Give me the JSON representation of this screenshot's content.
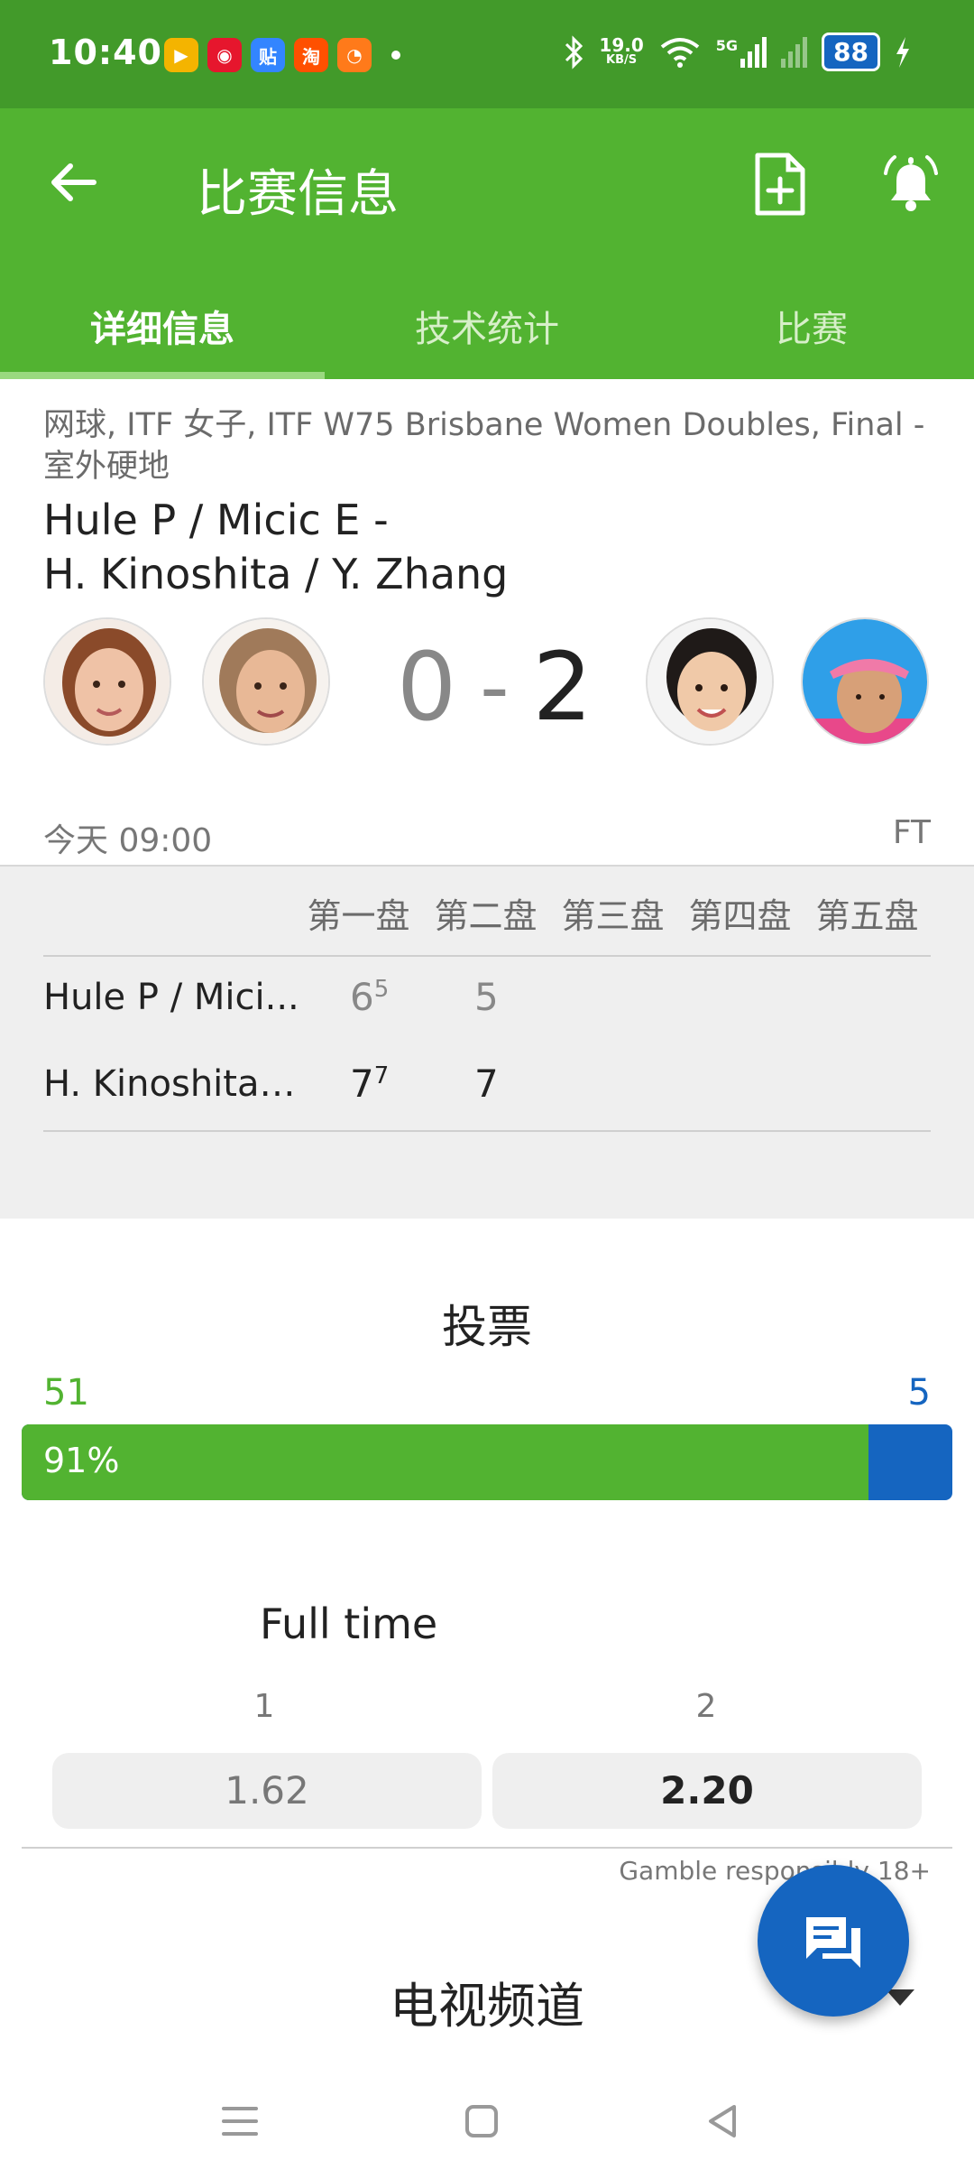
{
  "status_bar": {
    "time": "10:40",
    "net_speed_value": "19.0",
    "net_speed_unit": "KB/S",
    "network": "5G",
    "battery": "88",
    "app_icons": [
      {
        "name": "video-app-icon",
        "color": "#f4b400"
      },
      {
        "name": "weibo-icon",
        "color": "#e6162d"
      },
      {
        "name": "tieba-icon",
        "color": "#3385ff"
      },
      {
        "name": "taobao-icon",
        "color": "#ff5000"
      },
      {
        "name": "orange-app-icon",
        "color": "#ff7a1a"
      }
    ]
  },
  "app_bar": {
    "title": "比赛信息",
    "tabs": [
      {
        "label": "详细信息",
        "active": true
      },
      {
        "label": "技术统计",
        "active": false
      },
      {
        "label": "比赛",
        "active": false
      }
    ]
  },
  "match": {
    "league": "网球, ITF 女子, ITF W75 Brisbane Women Doubles, Final - 室外硬地",
    "team1": "Hule P / Micic E -",
    "team2": "H. Kinoshita / Y. Zhang",
    "score_home": "0",
    "score_sep": "-",
    "score_away": "2",
    "start_time": "今天 09:00",
    "status": "FT"
  },
  "sets": {
    "headers": [
      "第一盘",
      "第二盘",
      "第三盘",
      "第四盘",
      "第五盘"
    ],
    "rows": [
      {
        "team": "Hule P / Mici...",
        "set1": "6",
        "set1_tb": "5",
        "set2": "5"
      },
      {
        "team": "H. Kinoshita ...",
        "set1": "7",
        "set1_tb": "7",
        "set2": "7"
      }
    ]
  },
  "vote": {
    "title": "投票",
    "home_votes": "51",
    "away_votes": "5",
    "home_pct_label": "91%",
    "home_fraction": 0.91
  },
  "odds": {
    "title": "Full time",
    "label1": "1",
    "label2": "2",
    "value1": "1.62",
    "value2": "2.20",
    "disclaimer": "Gamble responsibly 18+"
  },
  "tv": {
    "title": "电视频道"
  },
  "colors": {
    "status_green": "#429a2a",
    "primary_green": "#52b331",
    "accent_blue": "#1565c0"
  }
}
